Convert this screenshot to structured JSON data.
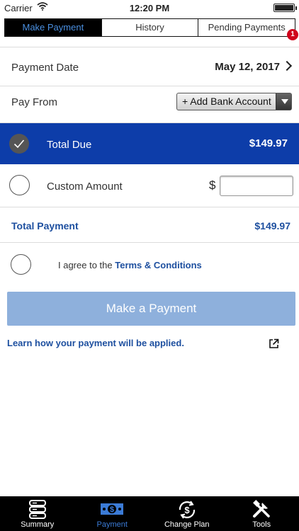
{
  "status_bar": {
    "carrier": "Carrier",
    "time": "12:20 PM"
  },
  "tabs": {
    "make_payment": "Make Payment",
    "history": "History",
    "pending_payments": "Pending Payments",
    "pending_badge": "1"
  },
  "payment_date": {
    "label": "Payment Date",
    "value": "May 12, 2017"
  },
  "pay_from": {
    "label": "Pay From",
    "selected": "+ Add Bank Account"
  },
  "total_due": {
    "label": "Total Due",
    "amount": "$149.97"
  },
  "custom_amount": {
    "label": "Custom Amount",
    "currency": "$",
    "value": "",
    "placeholder": ""
  },
  "total_payment": {
    "label": "Total Payment",
    "amount": "$149.97"
  },
  "agreement": {
    "prefix": "I agree to the ",
    "link": "Terms & Conditions"
  },
  "make_payment_button": "Make a Payment",
  "learn_link": "Learn how your payment will be applied.",
  "bottom_nav": [
    {
      "label": "Summary",
      "icon": "server-stack-icon"
    },
    {
      "label": "Payment",
      "icon": "money-bill-icon"
    },
    {
      "label": "Change Plan",
      "icon": "dollar-cycle-icon"
    },
    {
      "label": "Tools",
      "icon": "tools-icon"
    }
  ],
  "colors": {
    "accent_blue": "#0d3da9",
    "link_blue": "#1d4f9f",
    "button_disabled": "#8eb0dc",
    "badge_red": "#d0021b"
  }
}
